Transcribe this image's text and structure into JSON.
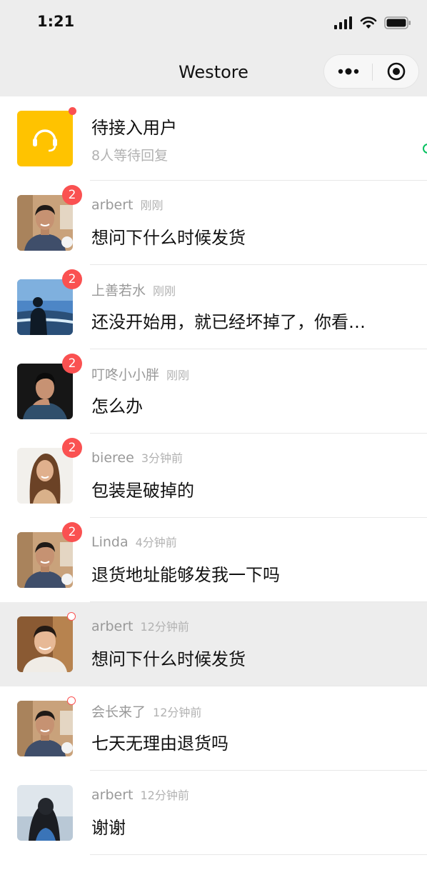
{
  "status_bar": {
    "time": "1:21"
  },
  "nav": {
    "title": "Westore"
  },
  "waiting_row": {
    "title": "待接入用户",
    "subtitle": "8人等待回复",
    "accent": "#ffc300"
  },
  "chats": [
    {
      "name": "arbert",
      "time": "刚刚",
      "message": "想问下什么时候发货",
      "badge": "2"
    },
    {
      "name": "上善若水",
      "time": "刚刚",
      "message": "还没开始用，就已经坏掉了，你看…",
      "badge": "2"
    },
    {
      "name": "叮咚小小胖",
      "time": "刚刚",
      "message": "怎么办",
      "badge": "2"
    },
    {
      "name": "bieree",
      "time": "3分钟前",
      "message": "包装是破掉的",
      "badge": "2"
    },
    {
      "name": "Linda",
      "time": "4分钟前",
      "message": "退货地址能够发我一下吗",
      "badge": "2"
    },
    {
      "name": "arbert",
      "time": "12分钟前",
      "message": "想问下什么时候发货"
    },
    {
      "name": "会长来了",
      "time": "12分钟前",
      "message": "七天无理由退货吗"
    },
    {
      "name": "arbert",
      "time": "12分钟前",
      "message": "谢谢"
    }
  ],
  "colors": {
    "badge": "#fa5151",
    "nav_background": "#ededed",
    "selected_row": "#ededed"
  },
  "icons": [
    "headset-icon",
    "more-icon",
    "close-target-icon",
    "signal-icon",
    "wifi-icon",
    "battery-icon"
  ]
}
